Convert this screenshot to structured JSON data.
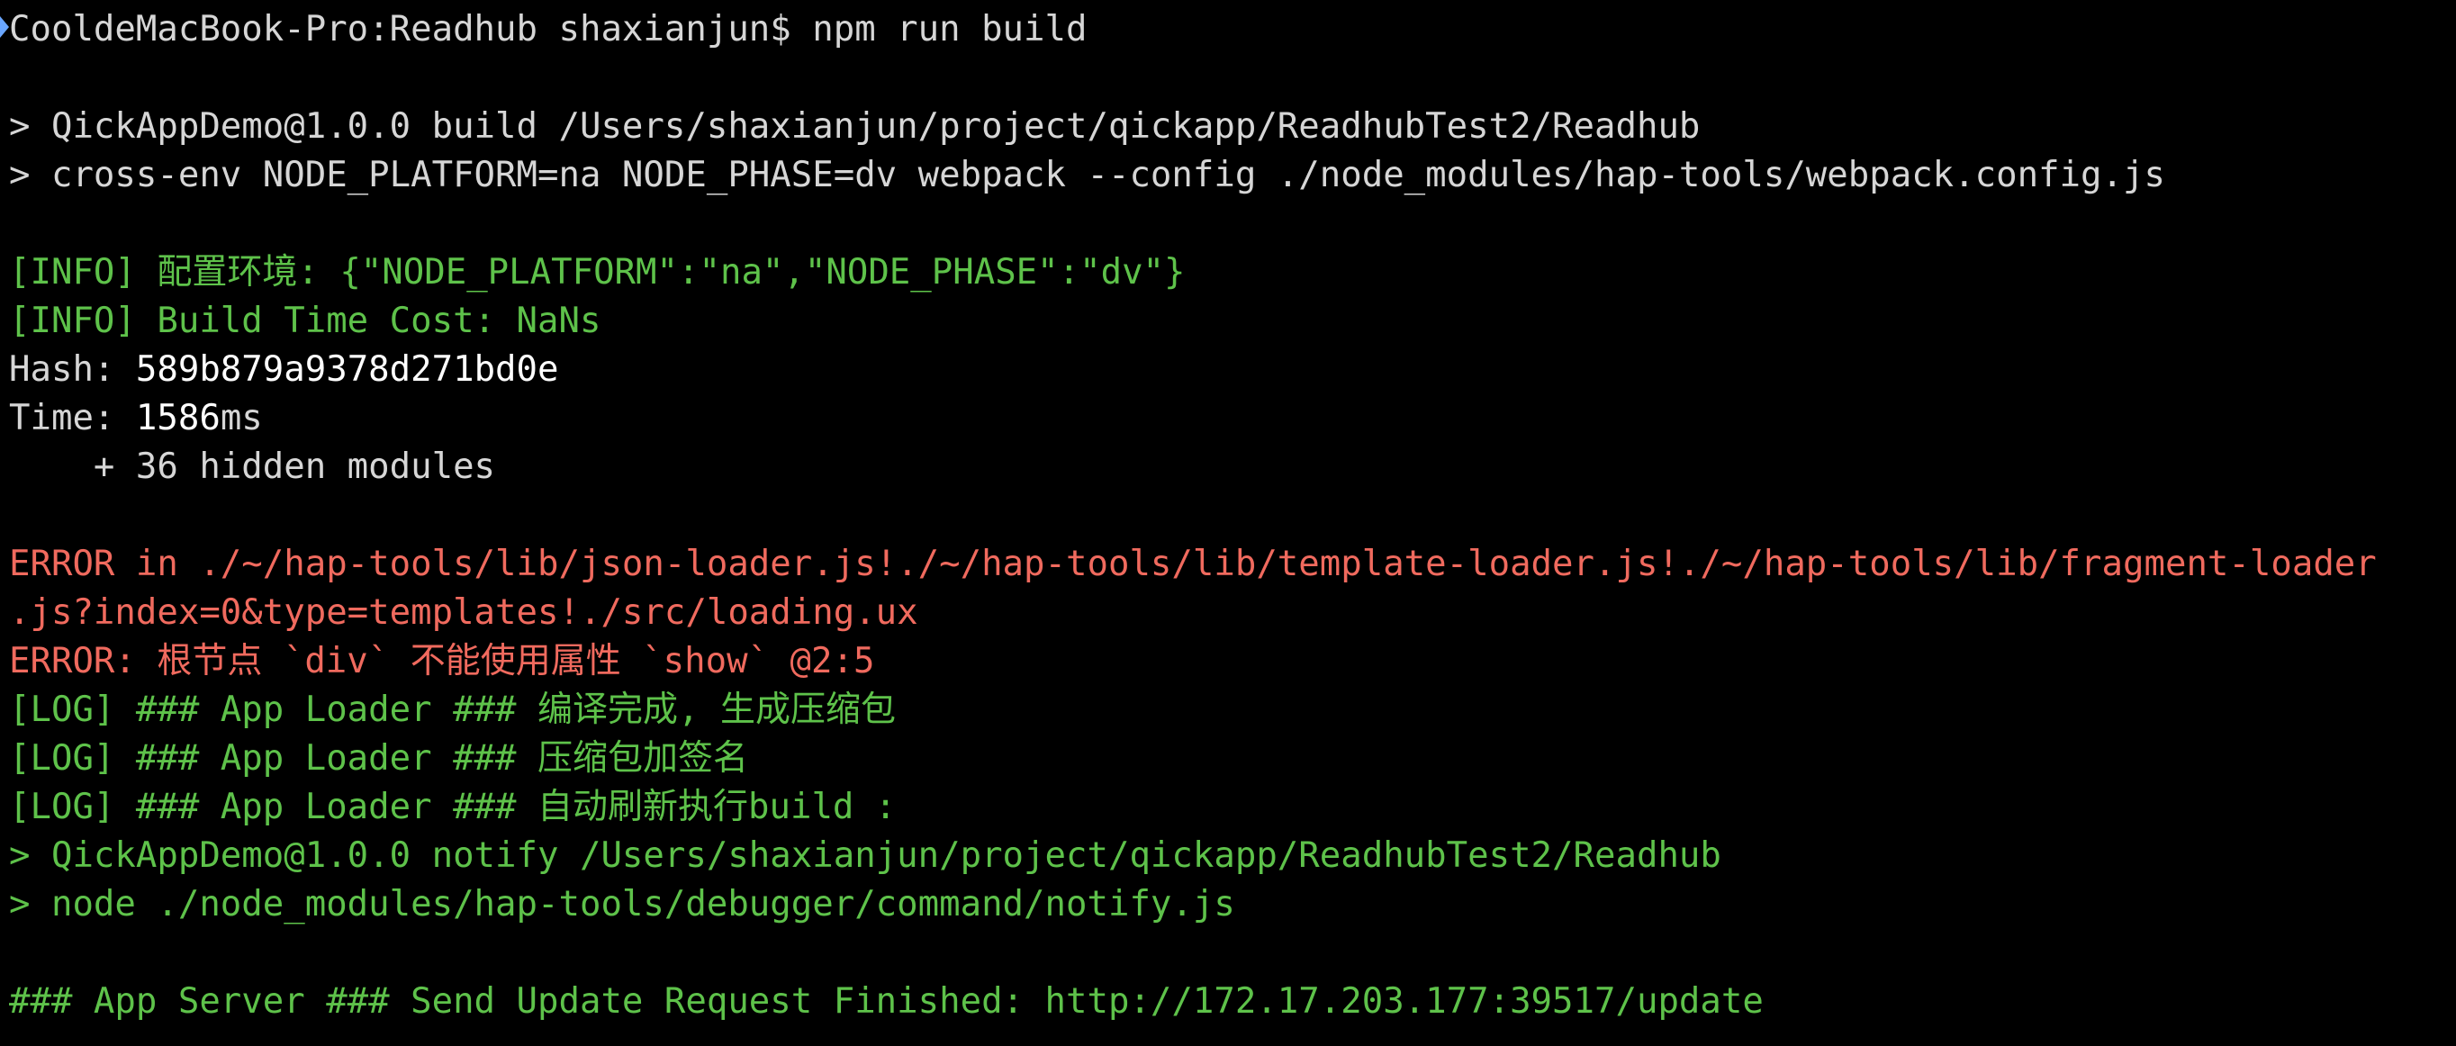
{
  "terminal": {
    "prompt": "CooldeMacBook-Pro:Readhub shaxianjun$ npm run build",
    "npm_header_1": "> QickAppDemo@1.0.0 build /Users/shaxianjun/project/qickapp/ReadhubTest2/Readhub",
    "npm_header_2": "> cross-env NODE_PLATFORM=na NODE_PHASE=dv webpack --config ./node_modules/hap-tools/webpack.config.js",
    "info_env": "[INFO] 配置环境: {\"NODE_PLATFORM\":\"na\",\"NODE_PHASE\":\"dv\"}",
    "info_time": "[INFO] Build Time Cost: NaNs",
    "hash_label": "Hash: ",
    "hash_value": "589b879a9378d271bd0e",
    "time_label": "Time: ",
    "time_value": "1586",
    "time_unit": "ms",
    "hidden_modules": "    + 36 hidden modules",
    "error_1a": "ERROR in ./~/hap-tools/lib/json-loader.js!./~/hap-tools/lib/template-loader.js!./~/hap-tools/lib/fragment-loader",
    "error_1b": ".js?index=0&type=templates!./src/loading.ux",
    "error_2": "ERROR: 根节点 `div` 不能使用属性 `show` @2:5",
    "log_1": "[LOG] ### App Loader ### 编译完成, 生成压缩包",
    "log_2": "[LOG] ### App Loader ### 压缩包加签名",
    "log_3": "[LOG] ### App Loader ### 自动刷新执行build :",
    "notify_1": "> QickAppDemo@1.0.0 notify /Users/shaxianjun/project/qickapp/ReadhubTest2/Readhub",
    "notify_2": "> node ./node_modules/hap-tools/debugger/command/notify.js",
    "server_line": "### App Server ### Send Update Request Finished: http://172.17.203.177:39517/update"
  },
  "colors": {
    "background": "#000000",
    "default_text": "#d6d6d6",
    "info_green": "#5ec24a",
    "error_red": "#f06a5e",
    "highlight_white": "#ffffff"
  }
}
